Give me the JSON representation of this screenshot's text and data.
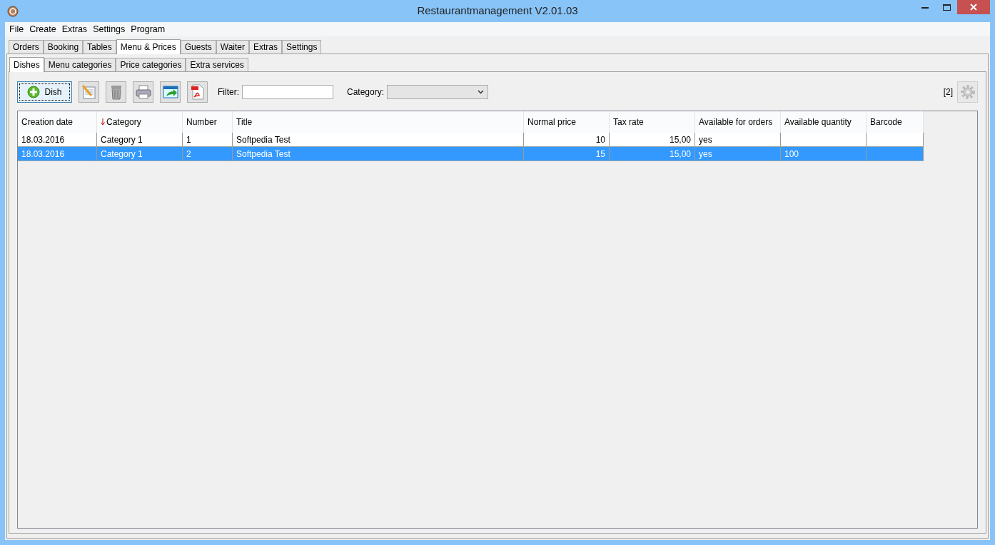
{
  "window": {
    "title": "Restaurantmanagement V2.01.03"
  },
  "menu": [
    "File",
    "Create",
    "Extras",
    "Settings",
    "Program"
  ],
  "tabs": [
    {
      "label": "Orders",
      "selected": false
    },
    {
      "label": "Booking",
      "selected": false
    },
    {
      "label": "Tables",
      "selected": false
    },
    {
      "label": "Menu & Prices",
      "selected": true
    },
    {
      "label": "Guests",
      "selected": false
    },
    {
      "label": "Waiter",
      "selected": false
    },
    {
      "label": "Extras",
      "selected": false
    },
    {
      "label": "Settings",
      "selected": false
    }
  ],
  "subtabs": [
    {
      "label": "Dishes",
      "selected": true
    },
    {
      "label": "Menu categories",
      "selected": false
    },
    {
      "label": "Price categories",
      "selected": false
    },
    {
      "label": "Extra services",
      "selected": false
    }
  ],
  "toolbar": {
    "add_button": "Dish",
    "filter_label": "Filter:",
    "category_label": "Category:",
    "count": "[2]"
  },
  "table": {
    "columns": [
      {
        "label": "Creation date",
        "sorted": false,
        "kind": "text"
      },
      {
        "label": "Category",
        "sorted": true,
        "kind": "text"
      },
      {
        "label": "Number",
        "sorted": false,
        "kind": "text"
      },
      {
        "label": "Title",
        "sorted": false,
        "kind": "text"
      },
      {
        "label": "Normal price",
        "sorted": false,
        "kind": "amount"
      },
      {
        "label": "Tax rate",
        "sorted": false,
        "kind": "amount"
      },
      {
        "label": "Available for orders",
        "sorted": false,
        "kind": "text"
      },
      {
        "label": "Available quantity",
        "sorted": false,
        "kind": "text"
      },
      {
        "label": "Barcode",
        "sorted": false,
        "kind": "text"
      }
    ],
    "rows": [
      {
        "selected": false,
        "cells": [
          "18.03.2016",
          "Category 1",
          "1",
          "Softpedia Test",
          "10",
          "15,00",
          "yes",
          "",
          ""
        ]
      },
      {
        "selected": true,
        "cells": [
          "18.03.2016",
          "Category 1",
          "2",
          "Softpedia Test",
          "15",
          "15,00",
          "yes",
          "100",
          ""
        ]
      }
    ]
  }
}
